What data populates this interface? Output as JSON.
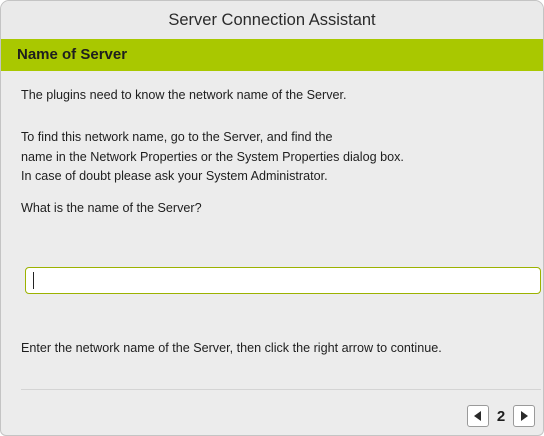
{
  "window": {
    "title": "Server Connection Assistant"
  },
  "section": {
    "title": "Name of Server"
  },
  "content": {
    "intro": "The plugins need to know the network name of the Server.",
    "instructions": [
      "To find this network name, go to the Server, and find the",
      "name in the Network Properties or the System Properties dialog box.",
      "In case of doubt please ask your System Administrator."
    ],
    "question": "What is the name of the Server?",
    "server_name_value": "",
    "hint": "Enter the network name of the Server, then click the right arrow to continue."
  },
  "navigation": {
    "page": "2",
    "prev_icon": "left-arrow-icon",
    "next_icon": "right-arrow-icon"
  },
  "colors": {
    "accent": "#a9c800",
    "input_border": "#9cb200",
    "window_bg": "#ececec"
  }
}
